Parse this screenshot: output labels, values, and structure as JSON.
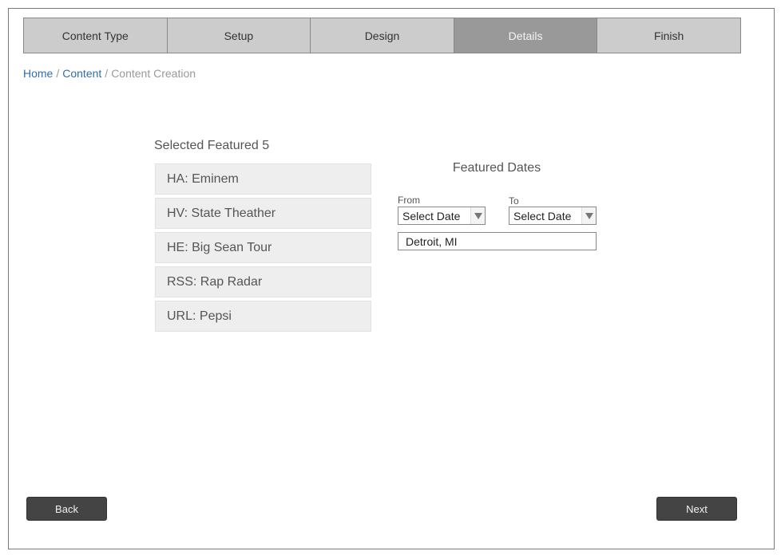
{
  "wizard": {
    "steps": [
      {
        "label": "Content Type"
      },
      {
        "label": "Setup"
      },
      {
        "label": "Design"
      },
      {
        "label": "Details"
      },
      {
        "label": "Finish"
      }
    ]
  },
  "breadcrumb": {
    "home": "Home",
    "content": "Content",
    "separator": "/",
    "current": "Content Creation"
  },
  "selected": {
    "title": "Selected Featured 5",
    "items": [
      {
        "label": "HA: Eminem"
      },
      {
        "label": "HV: State Theather"
      },
      {
        "label": "HE: Big Sean Tour"
      },
      {
        "label": "RSS: Rap Radar"
      },
      {
        "label": "URL: Pepsi"
      }
    ]
  },
  "dates": {
    "title": "Featured Dates",
    "from_label": "From",
    "to_label": "To",
    "from_value": "Select Date",
    "to_value": "Select Date",
    "location_value": "Detroit, MI"
  },
  "footer": {
    "back_label": "Back",
    "next_label": "Next"
  },
  "colors": {
    "step_bg": "#cccccc",
    "step_active_bg": "#999999",
    "link": "#2c6fb0",
    "button_bg": "#444444"
  }
}
